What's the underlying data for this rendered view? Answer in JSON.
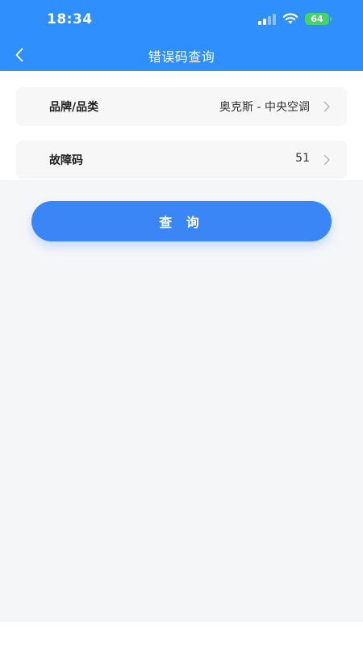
{
  "status_bar": {
    "time": "18:34",
    "battery": "64"
  },
  "nav": {
    "title": "错误码查询",
    "back_icon": "chevron-left-icon"
  },
  "form": {
    "brand_row": {
      "label": "品牌/品类",
      "value": "奥克斯 - 中央空调"
    },
    "error_code_row": {
      "label": "故障码",
      "value": "51"
    }
  },
  "actions": {
    "query_label": "查 询"
  },
  "colors": {
    "header_bg": "#2f8ffc",
    "primary": "#3a86f7",
    "battery": "#48d26a"
  }
}
